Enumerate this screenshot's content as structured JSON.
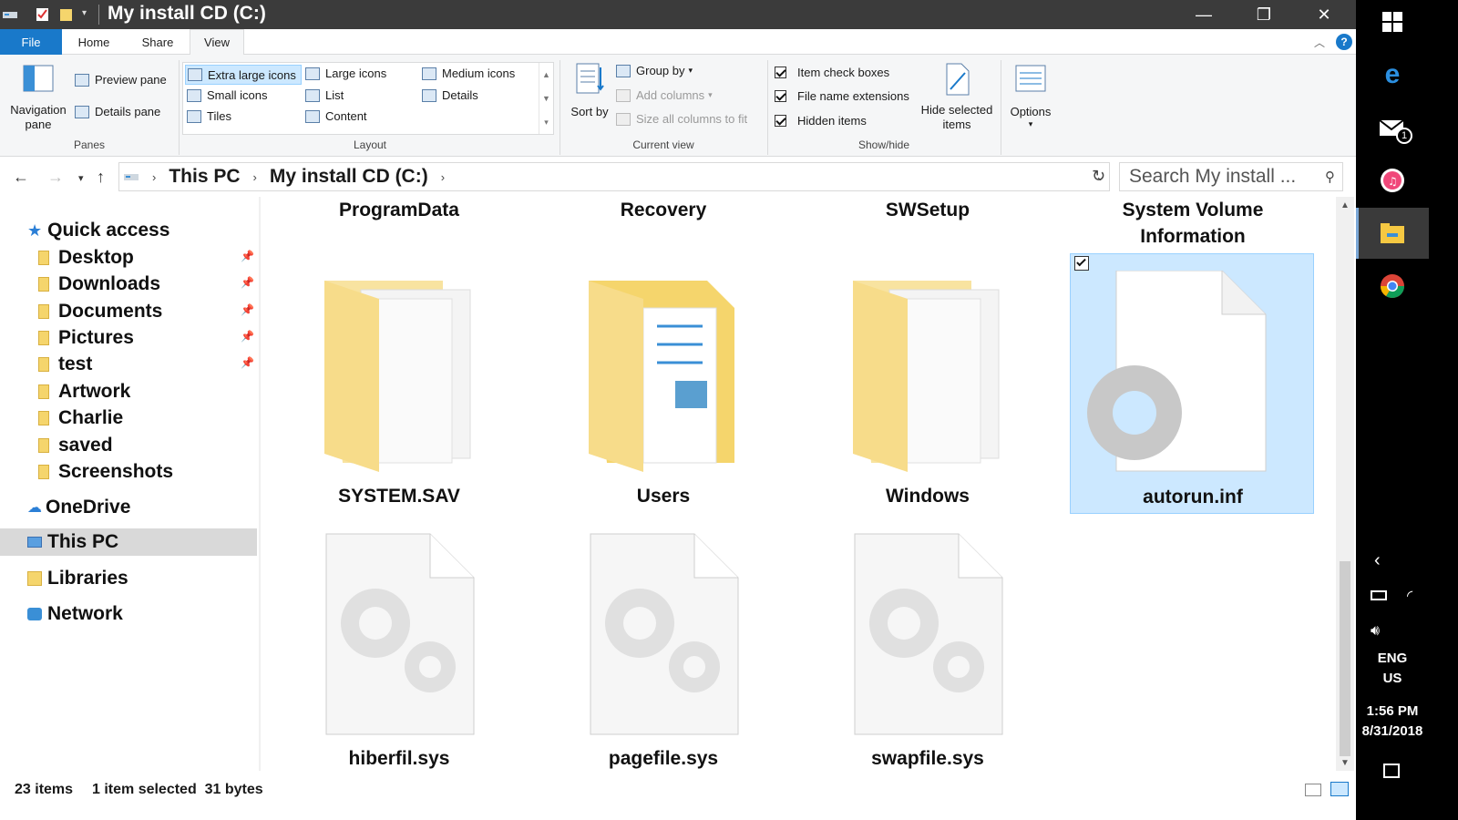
{
  "window": {
    "title": "My install CD (C:)",
    "controls": {
      "minimize": "—",
      "maximize": "❐",
      "close": "✕"
    }
  },
  "ribbon_tabs": [
    "File",
    "Home",
    "Share",
    "View"
  ],
  "ribbon": {
    "panes": {
      "navigation_pane": "Navigation pane",
      "preview_pane": "Preview pane",
      "details_pane": "Details pane",
      "label": "Panes"
    },
    "layout": {
      "options": [
        "Extra large icons",
        "Large icons",
        "Medium icons",
        "Small icons",
        "List",
        "Details",
        "Tiles",
        "Content"
      ],
      "selected": "Extra large icons",
      "label": "Layout"
    },
    "current_view": {
      "sort_by": "Sort by",
      "group_by": "Group by",
      "add_columns": "Add columns",
      "size_all_columns": "Size all columns to fit",
      "label": "Current view"
    },
    "show_hide": {
      "item_check_boxes": "Item check boxes",
      "file_name_extensions": "File name extensions",
      "hidden_items": "Hidden items",
      "hide_selected_items": "Hide selected items",
      "label": "Show/hide"
    },
    "options": "Options"
  },
  "address": {
    "crumbs": [
      "This PC",
      "My install CD (C:)"
    ],
    "search_placeholder": "Search My install ..."
  },
  "sidebar": {
    "quick_access": "Quick access",
    "pinned": [
      "Desktop",
      "Downloads",
      "Documents",
      "Pictures",
      "test"
    ],
    "folders": [
      "Artwork",
      "Charlie",
      "saved",
      "Screenshots"
    ],
    "onedrive": "OneDrive",
    "this_pc": "This PC",
    "libraries": "Libraries",
    "network": "Network"
  },
  "content": {
    "top_row": [
      "ProgramData",
      "Recovery",
      "SWSetup",
      "System Volume Information"
    ],
    "mid_row": [
      "SYSTEM.SAV",
      "Users",
      "Windows",
      "autorun.inf"
    ],
    "bottom_row": [
      "hiberfil.sys",
      "pagefile.sys",
      "swapfile.sys"
    ],
    "selected_item": "autorun.inf"
  },
  "status": {
    "items": "23 items",
    "selection": "1 item selected  31 bytes"
  },
  "taskbar": {
    "mail_badge": "1",
    "lang_line1": "ENG",
    "lang_line2": "US",
    "time": "1:56 PM",
    "date": "8/31/2018"
  },
  "colors": {
    "title_bar": "#3b3b3b",
    "file_tab": "#1979ca",
    "selection_fill": "#cce8ff",
    "selection_border": "#99d1ff",
    "folder": "#f5d56c",
    "taskbar": "#000000"
  }
}
